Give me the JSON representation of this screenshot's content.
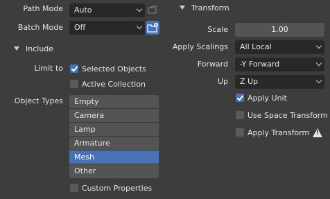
{
  "left": {
    "path_mode": {
      "label": "Path Mode",
      "value": "Auto"
    },
    "batch_mode": {
      "label": "Batch Mode",
      "value": "Off"
    },
    "include": {
      "title": "Include",
      "limit_to_label": "Limit to",
      "selected_objects": {
        "label": "Selected Objects",
        "checked": true
      },
      "active_collection": {
        "label": "Active Collection",
        "checked": false
      },
      "object_types_label": "Object Types",
      "object_types": [
        {
          "label": "Empty",
          "selected": false
        },
        {
          "label": "Camera",
          "selected": false
        },
        {
          "label": "Lamp",
          "selected": false
        },
        {
          "label": "Armature",
          "selected": false
        },
        {
          "label": "Mesh",
          "selected": true
        },
        {
          "label": "Other",
          "selected": false
        }
      ],
      "custom_properties": {
        "label": "Custom Properties",
        "checked": false
      }
    }
  },
  "right": {
    "transform": {
      "title": "Transform",
      "scale": {
        "label": "Scale",
        "value": "1.00"
      },
      "apply_scalings": {
        "label": "Apply Scalings",
        "value": "All Local"
      },
      "forward": {
        "label": "Forward",
        "value": "-Y Forward"
      },
      "up": {
        "label": "Up",
        "value": "Z Up"
      },
      "apply_unit": {
        "label": "Apply Unit",
        "checked": true
      },
      "use_space_transform": {
        "label": "Use Space Transform",
        "checked": false
      },
      "apply_transform": {
        "label": "Apply Transform",
        "checked": false
      }
    }
  },
  "colors": {
    "background": "#3d3d3d",
    "field": "#282828",
    "accent": "#4772b3",
    "list_item": "#545454"
  },
  "icons": [
    "chevron-down-icon",
    "disclosure-triangle-icon",
    "embed-file-icon",
    "new-folder-icon",
    "warning-icon",
    "checkmark-icon"
  ]
}
